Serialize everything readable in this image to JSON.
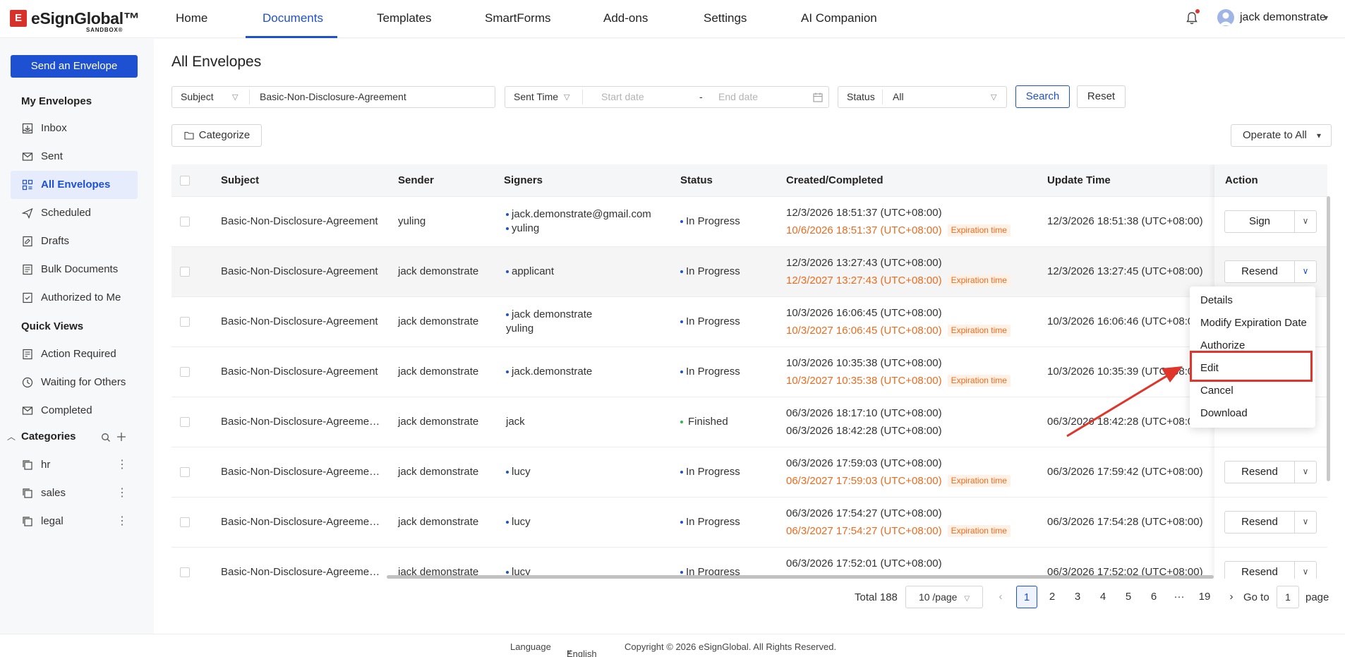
{
  "brand": {
    "logo_letter": "E",
    "name": "eSignGlobal™",
    "sub": "SANDBOX®"
  },
  "nav": {
    "items": [
      "Home",
      "Documents",
      "Templates",
      "SmartForms",
      "Add-ons",
      "Settings",
      "AI Companion"
    ],
    "active": "Documents",
    "user": "jack demonstrate",
    "accent": "#1e50d2"
  },
  "sidebar": {
    "send_button": "Send an Envelope",
    "my_envelopes": "My Envelopes",
    "items": [
      "Inbox",
      "Sent",
      "All Envelopes",
      "Scheduled",
      "Drafts",
      "Bulk Documents",
      "Authorized to Me"
    ],
    "quick_views": "Quick Views",
    "quick_items": [
      "Action Required",
      "Waiting for Others",
      "Completed"
    ],
    "categories": "Categories",
    "category_items": [
      "hr",
      "sales",
      "legal"
    ]
  },
  "main": {
    "title": "All Envelopes",
    "filters": {
      "subject_label": "Subject",
      "subject_value": "Basic-Non-Disclosure-Agreement",
      "time_label": "Sent Time",
      "start_placeholder": "Start date",
      "date_sep": "-",
      "end_placeholder": "End date",
      "status_label": "Status",
      "status_value": "All",
      "search": "Search",
      "reset": "Reset"
    },
    "categorize": "Categorize",
    "operate": "Operate to All"
  },
  "table": {
    "headers": [
      "Subject",
      "Sender",
      "Signers",
      "Status",
      "Created/Completed",
      "Update Time",
      "Action"
    ],
    "expiration_tag": "Expiration time",
    "rows": [
      {
        "subject": "Basic-Non-Disclosure-Agreement",
        "sender": "yuling",
        "signers": [
          "jack.demonstrate@gmail.com",
          "yuling"
        ],
        "status": "In Progress",
        "created": "12/3/2026 18:51:37 (UTC+08:00)",
        "second": "10/6/2026 18:51:37 (UTC+08:00)",
        "update": "12/3/2026 18:51:38 (UTC+08:00)",
        "action": "Sign"
      },
      {
        "subject": "Basic-Non-Disclosure-Agreement",
        "sender": "jack demonstrate",
        "signers": [
          "applicant"
        ],
        "status": "In Progress",
        "created": "12/3/2026 13:27:43 (UTC+08:00)",
        "second": "12/3/2027 13:27:43 (UTC+08:00)",
        "update": "12/3/2026 13:27:45 (UTC+08:00)",
        "action": "Resend"
      },
      {
        "subject": "Basic-Non-Disclosure-Agreement",
        "sender": "jack demonstrate",
        "signers": [
          "jack demonstrate",
          "yuling"
        ],
        "status": "In Progress",
        "created": "10/3/2026 16:06:45 (UTC+08:00)",
        "second": "10/3/2027 16:06:45 (UTC+08:00)",
        "update": "10/3/2026 16:06:46 (UTC+08:00)",
        "action": ""
      },
      {
        "subject": "Basic-Non-Disclosure-Agreement",
        "sender": "jack demonstrate",
        "signers": [
          "jack.demonstrate"
        ],
        "status": "In Progress",
        "created": "10/3/2026 10:35:38 (UTC+08:00)",
        "second": "10/3/2027 10:35:38 (UTC+08:00)",
        "update": "10/3/2026 10:35:39 (UTC+08:00)",
        "action": ""
      },
      {
        "subject": "Basic-Non-Disclosure-Agreeme…",
        "sender": "jack demonstrate",
        "signers": [
          "jack"
        ],
        "status": "Finished",
        "created": "06/3/2026 18:17:10 (UTC+08:00)",
        "second": "06/3/2026 18:42:28 (UTC+08:00)",
        "update": "06/3/2026 18:42:28 (UTC+08:00)",
        "action": ""
      },
      {
        "subject": "Basic-Non-Disclosure-Agreeme…",
        "sender": "jack demonstrate",
        "signers": [
          "lucy"
        ],
        "status": "In Progress",
        "created": "06/3/2026 17:59:03 (UTC+08:00)",
        "second": "06/3/2027 17:59:03 (UTC+08:00)",
        "update": "06/3/2026 17:59:42 (UTC+08:00)",
        "action": "Resend"
      },
      {
        "subject": "Basic-Non-Disclosure-Agreeme…",
        "sender": "jack demonstrate",
        "signers": [
          "lucy"
        ],
        "status": "In Progress",
        "created": "06/3/2026 17:54:27 (UTC+08:00)",
        "second": "06/3/2027 17:54:27 (UTC+08:00)",
        "update": "06/3/2026 17:54:28 (UTC+08:00)",
        "action": "Resend"
      },
      {
        "subject": "Basic-Non-Disclosure-Agreeme…",
        "sender": "jack demonstrate",
        "signers": [
          "lucy"
        ],
        "status": "In Progress",
        "created": "06/3/2026 17:52:01 (UTC+08:00)",
        "second": "",
        "update": "06/3/2026 17:52:02 (UTC+08:00)",
        "action": "Resend"
      }
    ]
  },
  "menu": {
    "items": [
      "Details",
      "Modify Expiration Date",
      "Authorize",
      "Edit",
      "Cancel",
      "Download"
    ],
    "highlighted": "Edit",
    "highlight_color": "#e0352b"
  },
  "pagination": {
    "total": "Total 188",
    "page_size": "10 /page",
    "pages": [
      "1",
      "2",
      "3",
      "4",
      "5",
      "6",
      "···",
      "19"
    ],
    "current": "1",
    "goto_label": "Go to",
    "goto_value": "1",
    "page_suffix": "page"
  },
  "footer": {
    "language_label": "Language",
    "language_value": "English",
    "copyright": "Copyright © 2026 eSignGlobal. All Rights Reserved."
  }
}
